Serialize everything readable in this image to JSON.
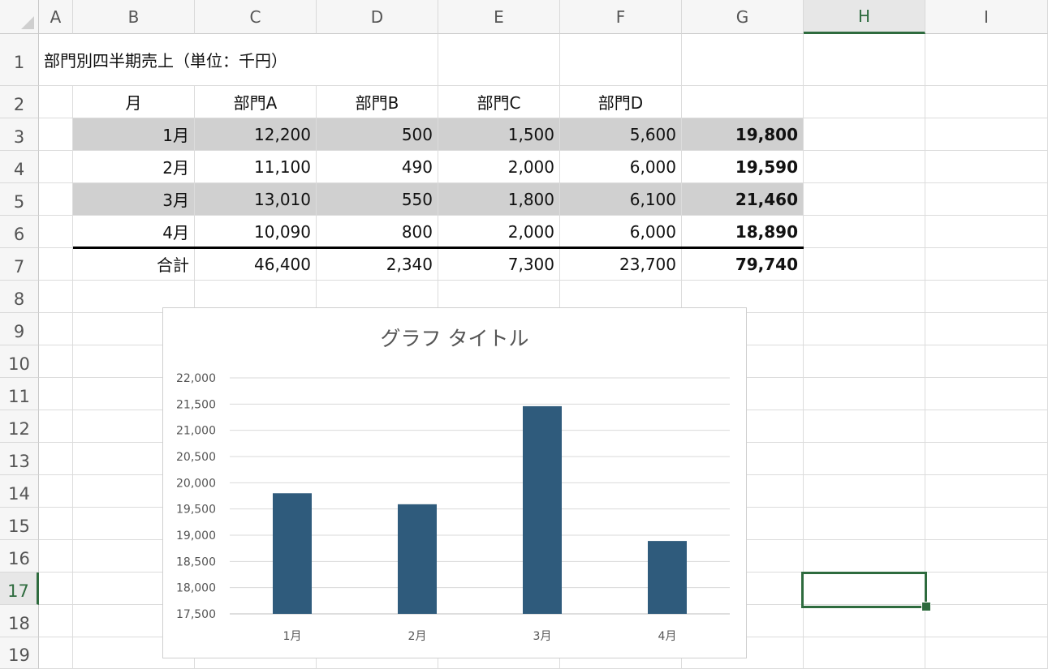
{
  "columns": [
    "A",
    "B",
    "C",
    "D",
    "E",
    "F",
    "G",
    "H",
    "I"
  ],
  "rows": [
    "1",
    "2",
    "3",
    "4",
    "5",
    "6",
    "7",
    "8",
    "9",
    "10",
    "11",
    "12",
    "13",
    "14",
    "15",
    "16",
    "17",
    "18",
    "19"
  ],
  "active_column": "H",
  "active_row": "17",
  "table": {
    "title": "部門別四半期売上（単位：千円）",
    "headers": [
      "月",
      "部門A",
      "部門B",
      "部門C",
      "部門D",
      ""
    ],
    "data_rows": [
      [
        "1月",
        "12,200",
        "500",
        "1,500",
        "5,600",
        "19,800"
      ],
      [
        "2月",
        "11,100",
        "490",
        "2,000",
        "6,000",
        "19,590"
      ],
      [
        "3月",
        "13,010",
        "550",
        "1,800",
        "6,100",
        "21,460"
      ],
      [
        "4月",
        "10,090",
        "800",
        "2,000",
        "6,000",
        "18,890"
      ]
    ],
    "total_row": [
      "合計",
      "46,400",
      "2,340",
      "7,300",
      "23,700",
      "79,740"
    ]
  },
  "colors": {
    "bar": "#2f5b7c",
    "selection": "#2e6b3e",
    "shade": "#d0d0d0"
  },
  "chart_data": {
    "type": "bar",
    "title": "グラフ タイトル",
    "categories": [
      "1月",
      "2月",
      "3月",
      "4月"
    ],
    "values": [
      19800,
      19590,
      21460,
      18890
    ],
    "ylim": [
      17500,
      22000
    ],
    "yticks": [
      17500,
      18000,
      18500,
      19000,
      19500,
      20000,
      20500,
      21000,
      21500,
      22000
    ],
    "ytick_labels": [
      "17,500",
      "18,000",
      "18,500",
      "19,000",
      "19,500",
      "20,000",
      "20,500",
      "21,000",
      "21,500",
      "22,000"
    ],
    "xlabel": "",
    "ylabel": "",
    "grid": true,
    "legend": "none"
  }
}
